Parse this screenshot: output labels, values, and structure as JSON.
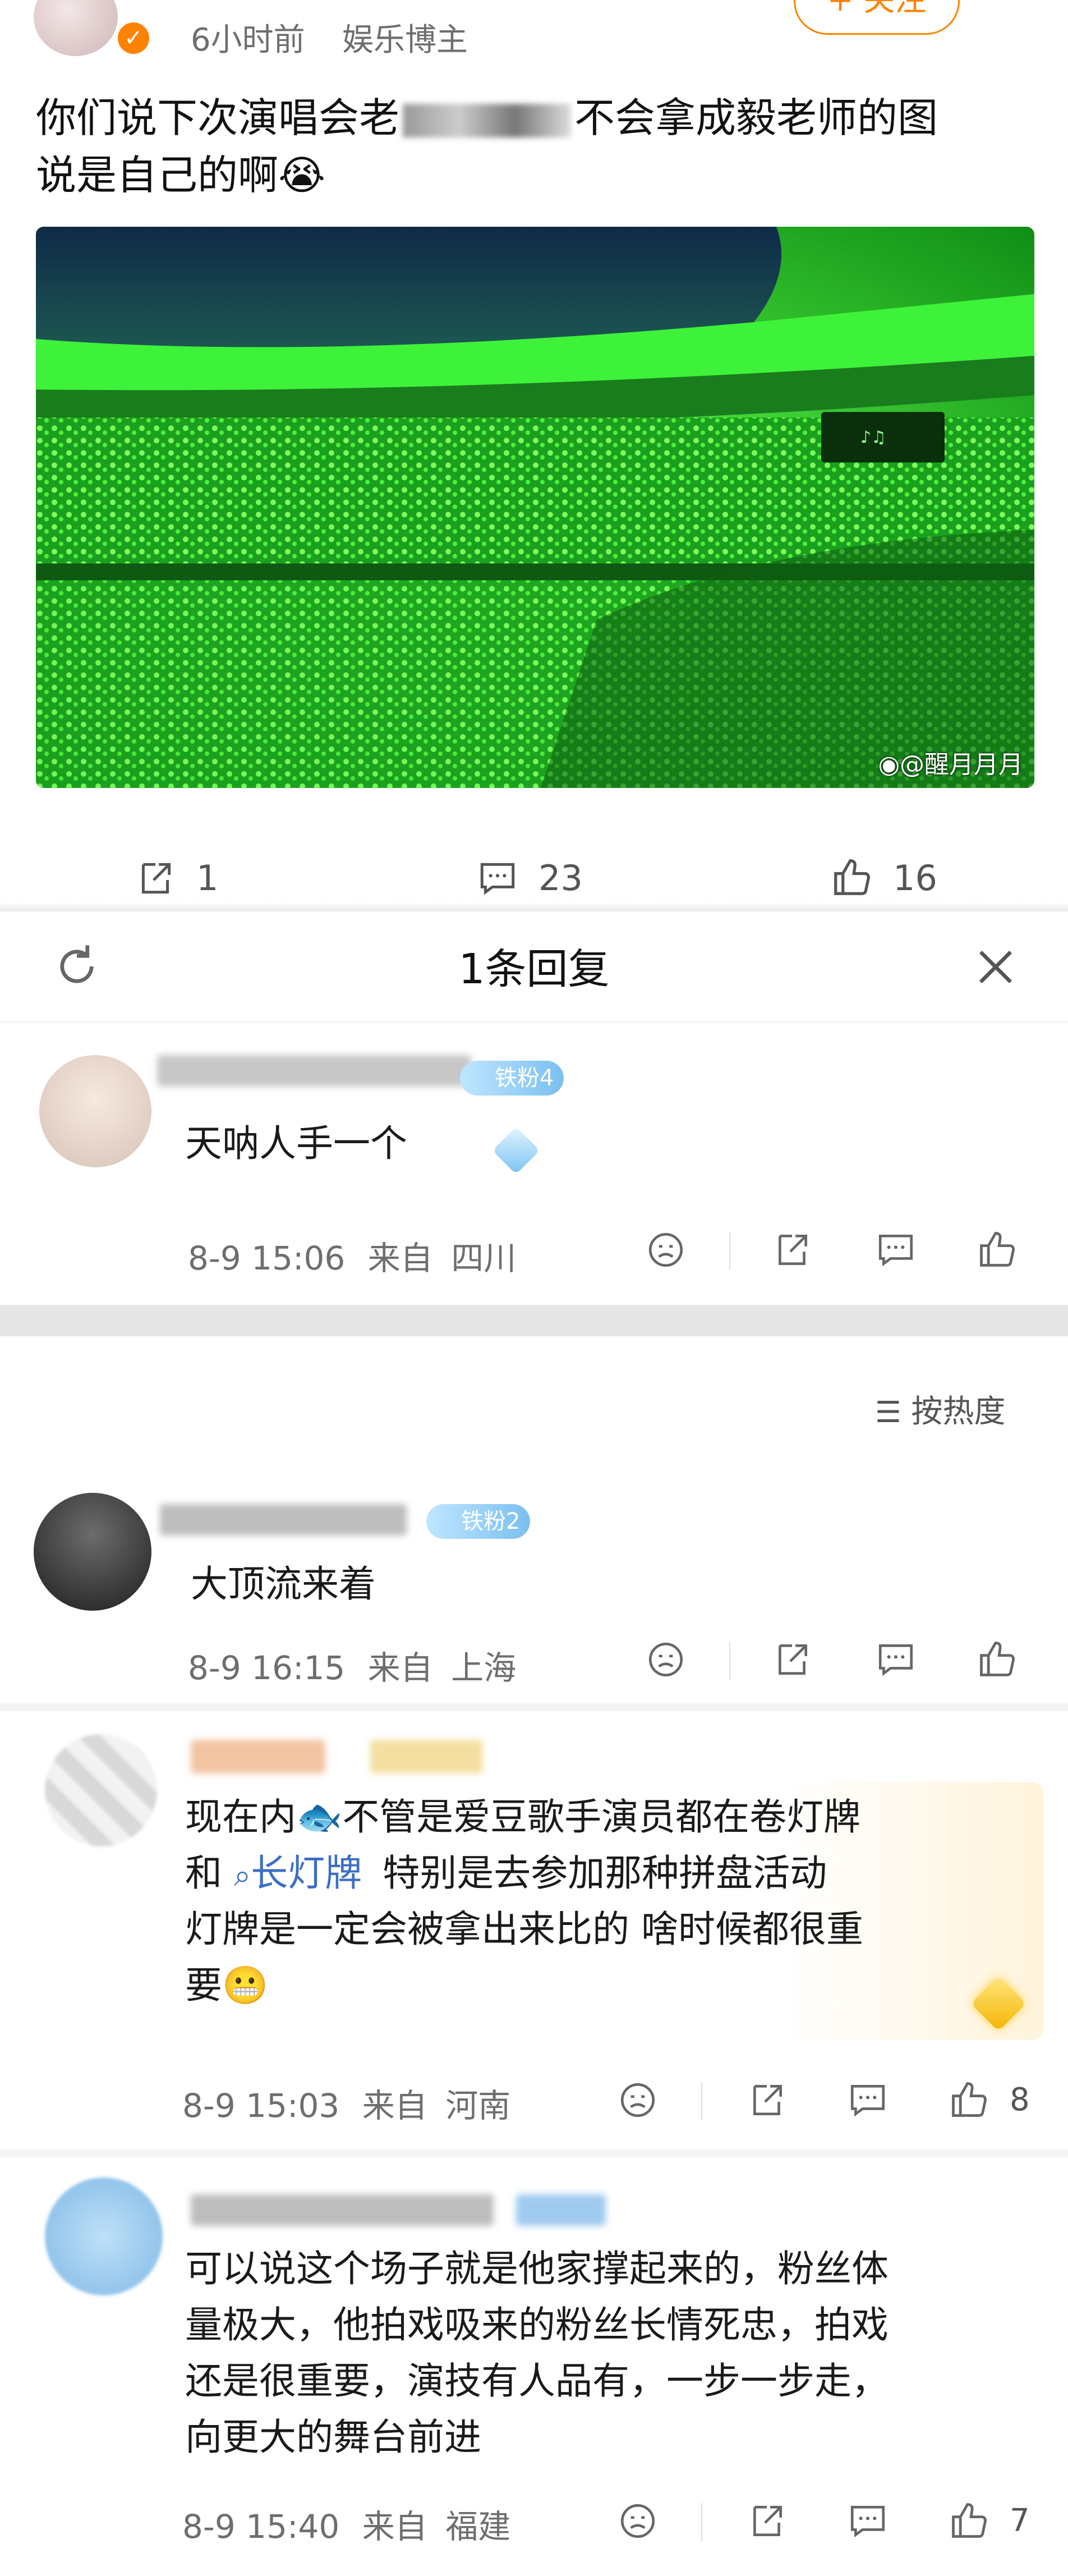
{
  "post": {
    "time": "6小时前",
    "source": "娱乐博主",
    "follow_label": "+ 关注",
    "text_line1": "你们说下次演唱会老",
    "text_line1_tail": "不会拿成毅老师的图",
    "text_line2": "说是自己的啊😭",
    "image_watermark": "@醒月月月",
    "share_count": "1",
    "comment_count": "23",
    "like_count": "16"
  },
  "reply_panel": {
    "title": "1条回复",
    "reply": {
      "badge": "铁粉4",
      "text": "天呐人手一个",
      "date": "8-9 15:06",
      "from_label": "来自",
      "location": "四川"
    }
  },
  "sort": {
    "label": "按热度"
  },
  "comments": [
    {
      "badge": "铁粉2",
      "text_lines": [
        "大顶流来着"
      ],
      "date": "8-9 16:15",
      "from_label": "来自",
      "location": "上海",
      "like_count": ""
    },
    {
      "text_line1_prefix": "现在内",
      "text_line1_suffix": "不管是爱豆歌手演员都在卷灯牌",
      "text_line2_prefix": "和",
      "search_link": "长灯牌",
      "text_line2_suffix": "特别是去参加那种拼盘活动",
      "text_line3": "灯牌是一定会被拿出来比的 啥时候都很重",
      "text_line4": "要😬",
      "date": "8-9 15:03",
      "from_label": "来自",
      "location": "河南",
      "like_count": "8"
    },
    {
      "text_lines": [
        "可以说这个场子就是他家撑起来的，粉丝体",
        "量极大，他拍戏吸来的粉丝长情死忠，拍戏",
        "还是很重要，演技有人品有，一步一步走，",
        "向更大的舞台前进"
      ],
      "date": "8-9 15:40",
      "from_label": "来自",
      "location": "福建",
      "like_count": "7"
    }
  ],
  "colors": {
    "accent": "#ff8200",
    "link": "#3c6ec4",
    "stadium_green": "#39ff3a"
  }
}
